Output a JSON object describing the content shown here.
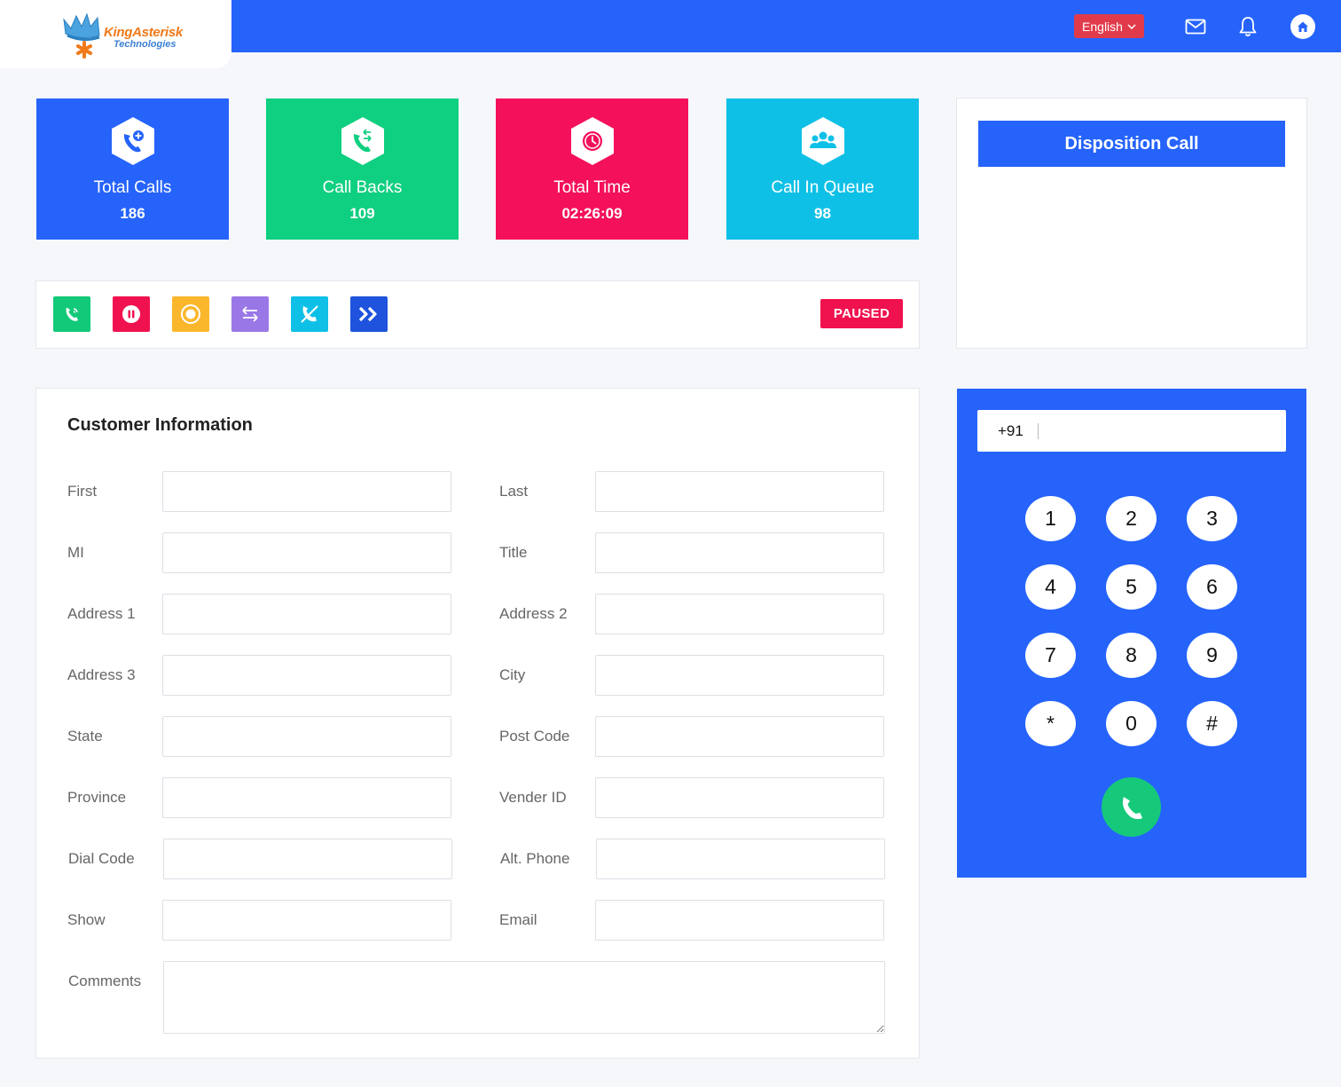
{
  "brand": {
    "name": "KingAsterisk",
    "sub": "Technologies",
    "colors": {
      "primary": "#2563fb",
      "orange": "#f07a1a"
    }
  },
  "header": {
    "language": "English",
    "icons": [
      "mail-icon",
      "bell-icon",
      "home-icon"
    ]
  },
  "stats": [
    {
      "label": "Total Calls",
      "value": "186",
      "color": "#2563fb",
      "icon": "phone-plus-icon"
    },
    {
      "label": "Call Backs",
      "value": "109",
      "color": "#0fcf80",
      "icon": "callback-icon"
    },
    {
      "label": "Total Time",
      "value": "02:26:09",
      "color": "#f4105a",
      "icon": "clock-icon"
    },
    {
      "label": "Call In Queue",
      "value": "98",
      "color": "#0fc0e6",
      "icon": "users-icon"
    }
  ],
  "controls": {
    "buttons": [
      {
        "name": "call",
        "color": "#12c979",
        "icon": "phone-icon"
      },
      {
        "name": "pause",
        "color": "#f0124f",
        "icon": "pause-icon"
      },
      {
        "name": "record",
        "color": "#fbb72c",
        "icon": "record-icon"
      },
      {
        "name": "transfer",
        "color": "#9a77e6",
        "icon": "transfer-icon"
      },
      {
        "name": "hangup",
        "color": "#0fc0e6",
        "icon": "phone-off-icon"
      },
      {
        "name": "next",
        "color": "#1f53dd",
        "icon": "double-chevron-icon"
      }
    ],
    "status": "PAUSED"
  },
  "disposition": {
    "button": "Disposition Call"
  },
  "customer": {
    "title": "Customer Information",
    "fields": [
      {
        "label": "First",
        "value": ""
      },
      {
        "label": "Last",
        "value": ""
      },
      {
        "label": "MI",
        "value": ""
      },
      {
        "label": "Title",
        "value": ""
      },
      {
        "label": "Address 1",
        "value": ""
      },
      {
        "label": "Address 2",
        "value": ""
      },
      {
        "label": "Address 3",
        "value": ""
      },
      {
        "label": "City",
        "value": ""
      },
      {
        "label": "State",
        "value": ""
      },
      {
        "label": "Post Code",
        "value": ""
      },
      {
        "label": "Province",
        "value": ""
      },
      {
        "label": "Vender ID",
        "value": ""
      },
      {
        "label": "Dial Code",
        "value": ""
      },
      {
        "label": "Alt. Phone",
        "value": ""
      },
      {
        "label": "Show",
        "value": ""
      },
      {
        "label": "Email",
        "value": ""
      }
    ],
    "comments_label": "Comments",
    "comments_value": ""
  },
  "dialer": {
    "prefix": "+91",
    "number": "",
    "keys": [
      "1",
      "2",
      "3",
      "4",
      "5",
      "6",
      "7",
      "8",
      "9",
      "*",
      "0",
      "#"
    ],
    "call_color": "#16c97a"
  }
}
